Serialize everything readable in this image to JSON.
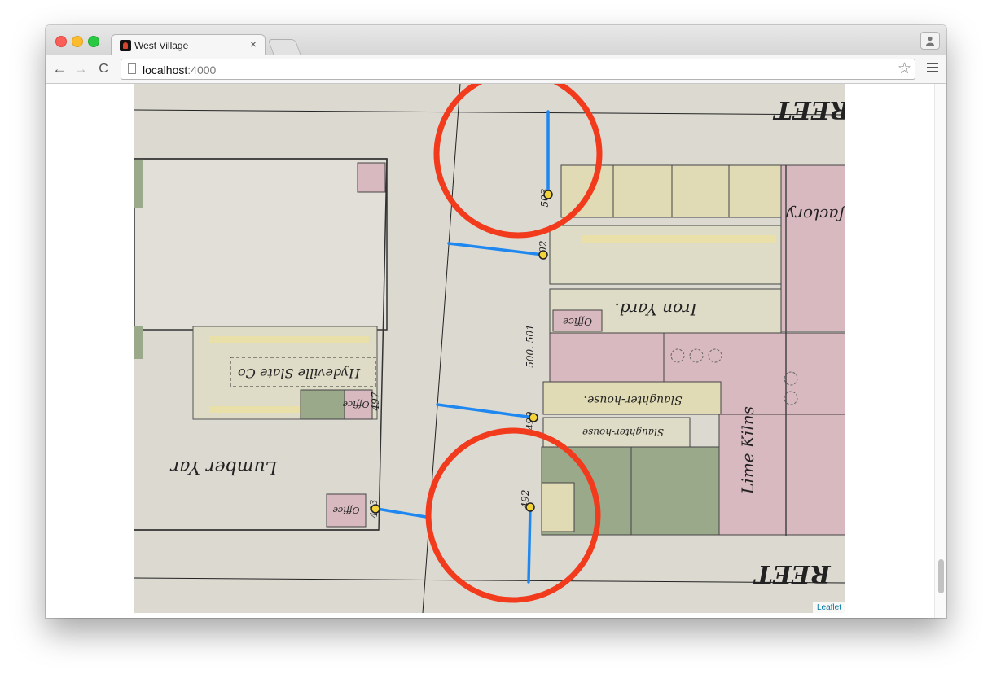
{
  "browser": {
    "tab_title": "West Village",
    "tab_close": "×",
    "url_host": "localhost",
    "url_port": ":4000",
    "star_glyph": "☆",
    "back_glyph": "←",
    "forward_glyph": "→",
    "reload_glyph": "C"
  },
  "map": {
    "labels": {
      "street_top": "REET",
      "street_bottom": "REET",
      "factory": "factory",
      "iron_yard": "Iron Yard.",
      "office": "Office",
      "slaughter_house": "Slaughter-house.",
      "slaughter_house_2": "Slaughter-house",
      "lime_kilns": "Lime Kilns",
      "slate_co": "Hydeville Slate Co",
      "lumber_yard": "Lumber Yar",
      "addr_500_501": "500. 501",
      "addr_497": "497",
      "addr_493": "493",
      "addr_492": "492",
      "addr_502": "502",
      "addr_503": "503",
      "addr_499": "499"
    },
    "attribution": "Leaflet",
    "colors": {
      "paper": "#dcd9d1",
      "pink": "#d8b9c0",
      "yellow": "#e0dbb4",
      "green": "#9aa98a",
      "link_line": "#1e88f0",
      "highlight_circle": "#f23a1c",
      "marker_fill": "#f3d33a"
    }
  }
}
